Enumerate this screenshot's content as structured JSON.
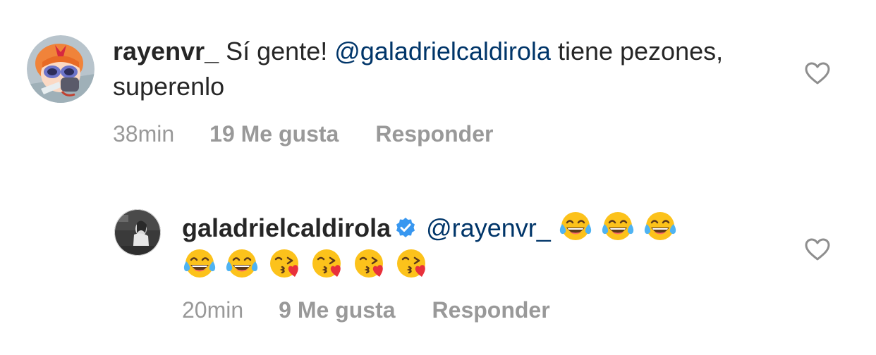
{
  "comments": [
    {
      "username": "rayenvr_",
      "text_before": " Sí gente! ",
      "mention": "@galadrielcaldirola",
      "text_after": " tiene pezones, superenlo",
      "time": "38min",
      "likes": "19 Me gusta",
      "reply_label": "Responder",
      "avatar_icon": "cartoon-avatar-icon",
      "like_icon": "heart-outline-icon"
    },
    {
      "username": "galadrielcaldirola",
      "verified_icon": "verified-badge-icon",
      "mention": "@rayenvr_",
      "emojis": [
        "face-with-tears-of-joy",
        "face-with-tears-of-joy",
        "face-with-tears-of-joy",
        "face-with-tears-of-joy",
        "face-with-tears-of-joy",
        "face-blowing-a-kiss",
        "face-blowing-a-kiss",
        "face-blowing-a-kiss",
        "face-blowing-a-kiss"
      ],
      "time": "20min",
      "likes": "9 Me gusta",
      "reply_label": "Responder",
      "avatar_icon": "profile-photo-icon",
      "like_icon": "heart-outline-icon"
    }
  ],
  "colors": {
    "text": "#262626",
    "mention": "#003569",
    "meta": "#999999",
    "verified": "#3897f0"
  }
}
